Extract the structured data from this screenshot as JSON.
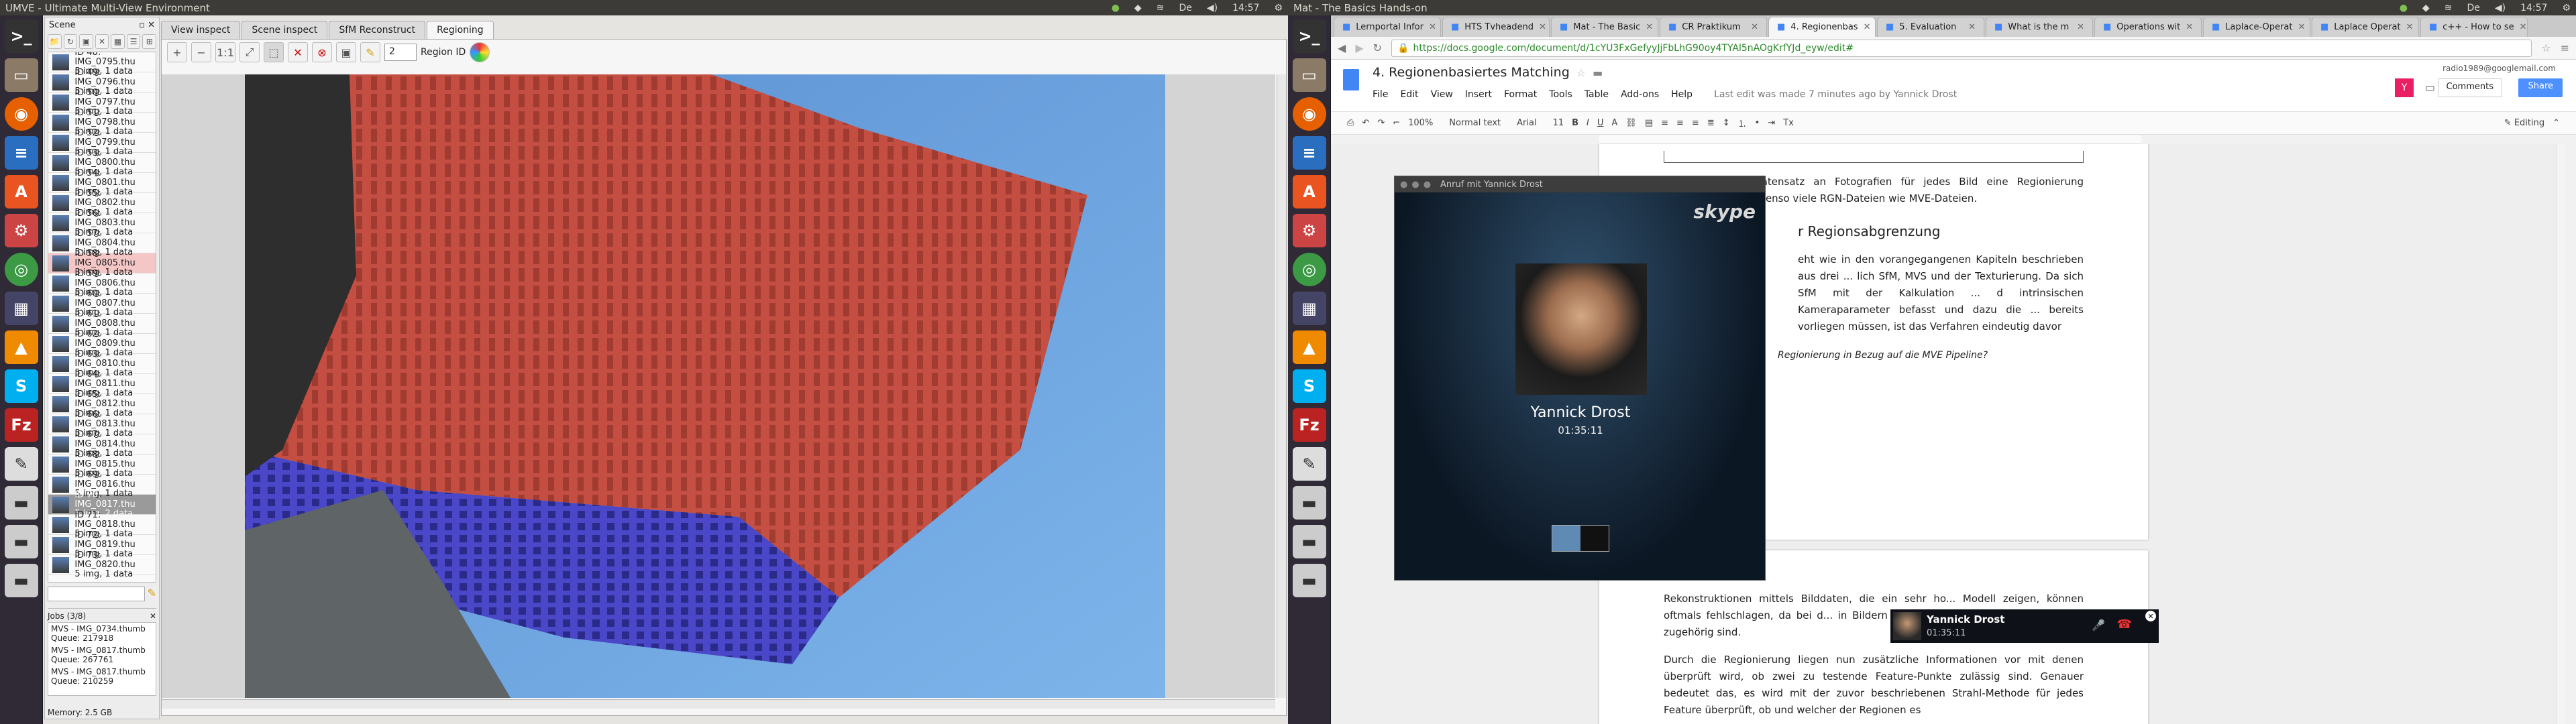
{
  "ubuntu_bar": {
    "left_title": "UMVE - Ultimate Multi-View Environment",
    "right_title": "Mat - The Basics Hands-on",
    "clock_left": "14:57",
    "clock_right": "14:57",
    "lang": "De"
  },
  "launcher": [
    "terminal-icon",
    "files-icon",
    "firefox-icon",
    "libreoffice-writer-icon",
    "ubuntu-software-icon",
    "system-settings-icon",
    "chrome-icon",
    "calculator-icon",
    "vlc-icon",
    "skype-icon",
    "filezilla-icon",
    "text-editor-icon",
    "drive-icon",
    "drive-icon",
    "drive-icon"
  ],
  "umve": {
    "scene_label": "Scene",
    "tabs": [
      "View inspect",
      "Scene inspect",
      "SfM Reconstruct",
      "Regioning"
    ],
    "active_tab": "Regioning",
    "region_label": "Region ID",
    "region_value": "2",
    "views": [
      {
        "id": "ID 48: IMG_0795.thu",
        "meta": "5 img, 1 data"
      },
      {
        "id": "ID 49: IMG_0796.thu",
        "meta": "5 img, 1 data"
      },
      {
        "id": "ID 50: IMG_0797.thu",
        "meta": "5 img, 1 data"
      },
      {
        "id": "ID 51: IMG_0798.thu",
        "meta": "5 img, 1 data"
      },
      {
        "id": "ID 52: IMG_0799.thu",
        "meta": "5 img, 1 data"
      },
      {
        "id": "ID 53: IMG_0800.thu",
        "meta": "5 img, 1 data"
      },
      {
        "id": "ID 54: IMG_0801.thu",
        "meta": "5 img, 1 data"
      },
      {
        "id": "ID 55: IMG_0802.thu",
        "meta": "5 img, 1 data"
      },
      {
        "id": "ID 56: IMG_0803.thu",
        "meta": "5 img, 1 data"
      },
      {
        "id": "ID 57: IMG_0804.thu",
        "meta": "5 img, 1 data"
      },
      {
        "id": "ID 58: IMG_0805.thu",
        "meta": "3 img, 1 data"
      },
      {
        "id": "ID 59: IMG_0806.thu",
        "meta": "5 img, 1 data"
      },
      {
        "id": "ID 60: IMG_0807.thu",
        "meta": "5 img, 1 data"
      },
      {
        "id": "ID 61: IMG_0808.thu",
        "meta": "5 img, 1 data"
      },
      {
        "id": "ID 62: IMG_0809.thu",
        "meta": "5 img, 1 data"
      },
      {
        "id": "ID 63: IMG_0810.thu",
        "meta": "5 img, 1 data"
      },
      {
        "id": "ID 64: IMG_0811.thu",
        "meta": "5 img, 1 data"
      },
      {
        "id": "ID 65: IMG_0812.thu",
        "meta": "5 img, 1 data"
      },
      {
        "id": "ID 66: IMG_0813.thu",
        "meta": "5 img, 1 data"
      },
      {
        "id": "ID 67: IMG_0814.thu",
        "meta": "5 img, 1 data"
      },
      {
        "id": "ID 68: IMG_0815.thu",
        "meta": "5 img, 1 data"
      },
      {
        "id": "ID 69: IMG_0816.thu",
        "meta": "5 img, 1 data"
      },
      {
        "id": "ID 70: IMG_0817.thu",
        "meta": "5 img, 2 data"
      },
      {
        "id": "ID 71: IMG_0818.thu",
        "meta": "5 img, 1 data"
      },
      {
        "id": "ID 72: IMG_0819.thu",
        "meta": "5 img, 1 data"
      },
      {
        "id": "ID 73: IMG_0820.thu",
        "meta": "5 img, 1 data"
      }
    ],
    "jobs_label": "Jobs (3/8)",
    "jobs": [
      {
        "name": "MVS - IMG_0734.thumb",
        "queue": "Queue: 217918"
      },
      {
        "name": "MVS - IMG_0817.thumb",
        "queue": "Queue: 267761"
      },
      {
        "name": "MVS - IMG_0817.thumb",
        "queue": "Queue: 210259"
      }
    ],
    "memory": "Memory: 2.5 GB"
  },
  "chrome": {
    "tabs": [
      "Lernportal Infor",
      "HTS Tvheadend",
      "Mat - The Basic",
      "CR Praktikum",
      "4. Regionenbas",
      "5. Evaluation",
      "What is the m",
      "Operations wit",
      "Laplace-Operat",
      "Laplace Operat",
      "c++ - How to se"
    ],
    "active_tab": "4. Regionenbas",
    "url": "https://docs.google.com/document/d/1cYU3FxGefyyJjFbLhG90oy4TYAl5nAOgKrfYJd_eyw/edit#"
  },
  "gdocs": {
    "title": "4. Regionenbasiertes Matching",
    "menu": [
      "File",
      "Edit",
      "View",
      "Insert",
      "Format",
      "Tools",
      "Table",
      "Add-ons",
      "Help"
    ],
    "last_edit": "Last edit was made 7 minutes ago by Yannick Drost",
    "user": "radio1989@googlemail.com",
    "comments": "Comments",
    "share": "Share",
    "editing": "Editing",
    "zoom": "100%",
    "style": "Normal text",
    "font": "Arial",
    "size": "11",
    "para1": "Falls für einen Datensatz an Fotografien für jedes Bild eine Regionierung vorgenommen ... ebenso viele RGN-Dateien wie MVE-Dateien.",
    "heading": "r Regionsabgrenzung",
    "para2": "eht wie in den vorangegangenen Kapiteln beschrieben aus drei ... lich SfM, MVS und der Texturierung. Da sich SfM mit der Kalkulation ... d intrinsischen Kameraparameter befasst und dazu die ... bereits vorliegen müssen, ist das Verfahren eindeutig davor",
    "caption": "Regionierung in Bezug auf die MVE Pipeline?",
    "para3": "Rekonstruktionen mittels Bilddaten, die ein sehr ho... Modell zeigen, können oftmals fehlschlagen, da bei d... in Bildern erfasst werden, die tatsächlich nicht zugehörig sind.",
    "para4": "Durch die Regionierung liegen nun zusätzliche Informationen vor mit denen überprüft wird, ob zwei zu testende Feature-Punkte zulässig sind. Genauer bedeutet das, es wird mit der zuvor beschriebenen Strahl-Methode für jedes Feature überprüft, ob und welcher der Regionen es"
  },
  "skype": {
    "window_title": "Anruf mit Yannick Drost",
    "brand": "skype",
    "name": "Yannick Drost",
    "time": "01:35:11",
    "mini_name": "Yannick Drost",
    "mini_time": "01:35:11"
  }
}
